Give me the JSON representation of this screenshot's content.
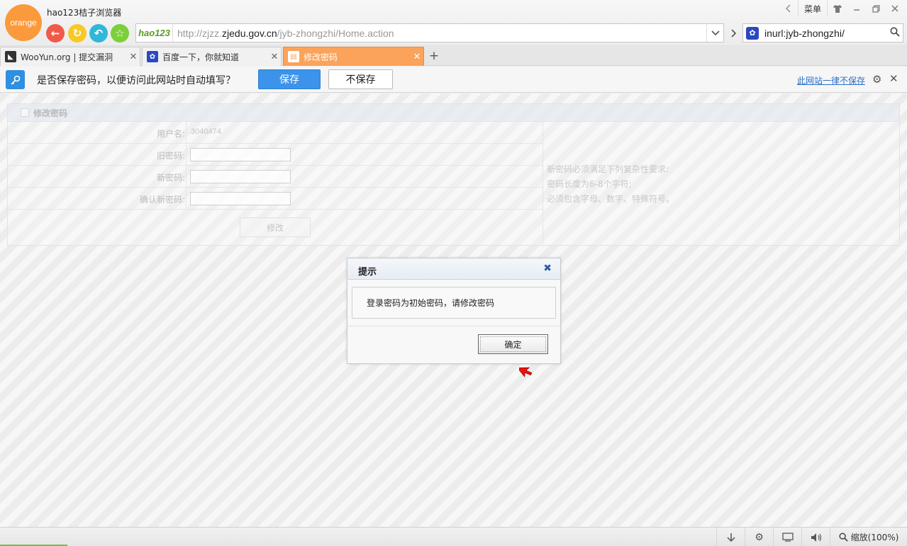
{
  "browser": {
    "logo_text": "orange",
    "title": "hao123桔子浏览器",
    "menu_label": "菜单",
    "address": {
      "badge": "hao123",
      "url_prefix": "http://zjzz.",
      "url_domain": "zjedu.gov.cn",
      "url_suffix": "/jyb-zhongzhi/Home.action"
    },
    "search_query": "inurl:jyb-zhongzhi/"
  },
  "tabs": [
    {
      "label": "WooYun.org | 提交漏洞",
      "active": false
    },
    {
      "label": "百度一下，你就知道",
      "active": false
    },
    {
      "label": "修改密码",
      "active": true
    }
  ],
  "password_bar": {
    "message": "是否保存密码，以便访问此网站时自动填写？",
    "save_label": "保存",
    "nosave_label": "不保存",
    "never_label": "此网站一律不保存"
  },
  "form": {
    "title": "修改密码",
    "username_label": "用户名:",
    "username_value": "3040474",
    "old_pw_label": "旧密码:",
    "new_pw_label": "新密码:",
    "confirm_pw_label": "确认新密码:",
    "submit_label": "修改",
    "hints": [
      "新密码必须满足下列复杂性要求:",
      "密码长度为6-8个字符;",
      "必须包含字母、数字、特殊符号。"
    ]
  },
  "dialog": {
    "title": "提示",
    "message": "登录密码为初始密码，请修改密码",
    "ok_label": "确定"
  },
  "statusbar": {
    "zoom_label": "缩放(100%)"
  },
  "colors": {
    "brand_orange": "#fa9a3c",
    "active_tab": "#fba35a",
    "save_button": "#3b93ea",
    "link": "#2a6fc9"
  }
}
